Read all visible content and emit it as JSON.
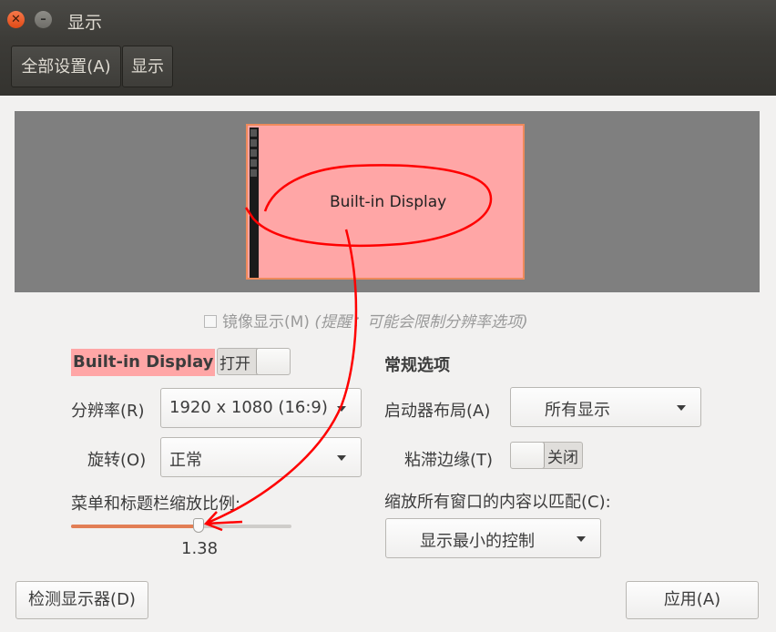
{
  "window": {
    "title": "显示"
  },
  "toolbar": {
    "all_settings_label": "全部设置(A)",
    "display_label": "显示"
  },
  "preview": {
    "monitor_label": "Built-in Display"
  },
  "mirror": {
    "label": "镜像显示(M)",
    "hint": "(提醒：可能会限制分辨率选项)",
    "checked": false
  },
  "display": {
    "name": "Built-in Display",
    "power_toggle_label": "打开",
    "power_on": false
  },
  "resolution": {
    "label": "分辨率(R)",
    "value": "1920 x 1080 (16:9)"
  },
  "rotation": {
    "label": "旋转(O)",
    "value": "正常"
  },
  "scale": {
    "label": "菜单和标题栏缩放比例:",
    "value_text": "1.38",
    "fraction": 0.58
  },
  "general": {
    "title": "常规选项",
    "launcher_label": "启动器布局(A)",
    "launcher_value": "所有显示",
    "sticky_label": "粘滞边缘(T)",
    "sticky_toggle_label": "关闭",
    "sticky_on": false,
    "scale_all_label": "缩放所有窗口的内容以匹配(C):",
    "scale_all_value": "显示最小的控制"
  },
  "buttons": {
    "detect_label": "检测显示器(D)",
    "apply_label": "应用(A)"
  },
  "colors": {
    "annotation": "#ff0000",
    "highlight": "#ffa6a6",
    "accent": "#e27e55"
  }
}
